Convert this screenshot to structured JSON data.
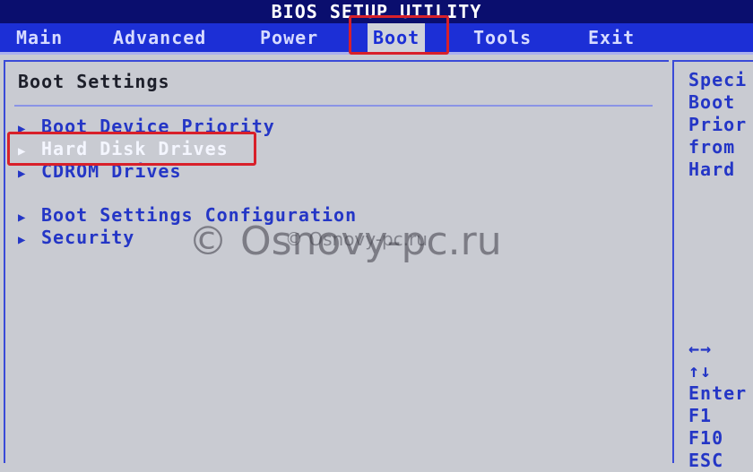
{
  "title": "BIOS SETUP UTILITY",
  "tabs": [
    {
      "label": "Main"
    },
    {
      "label": "Advanced"
    },
    {
      "label": "Power"
    },
    {
      "label": "Boot"
    },
    {
      "label": "Tools"
    },
    {
      "label": "Exit"
    }
  ],
  "active_tab": "Boot",
  "main": {
    "heading": "Boot Settings",
    "items": [
      {
        "label": "Boot Device Priority"
      },
      {
        "label": "Hard Disk Drives"
      },
      {
        "label": "CDROM Drives"
      },
      {
        "label": "Boot Settings Configuration"
      },
      {
        "label": "Security"
      }
    ],
    "selected_item": "Hard Disk Drives"
  },
  "help": {
    "lines": [
      "Speci",
      "Boot",
      "Prior",
      "from",
      "Hard"
    ],
    "keys": [
      "←→",
      "↑↓",
      "Enter",
      "F1",
      "F10",
      "ESC"
    ]
  },
  "watermark": {
    "main": "© Osnovy-pc.ru",
    "secondary": "© Osnovy-pc.ru"
  },
  "colors": {
    "menu_bar": "#1c2fd6",
    "title_bar": "#0a0e6e",
    "text": "#2436c6",
    "highlight_box": "#d8202a"
  }
}
